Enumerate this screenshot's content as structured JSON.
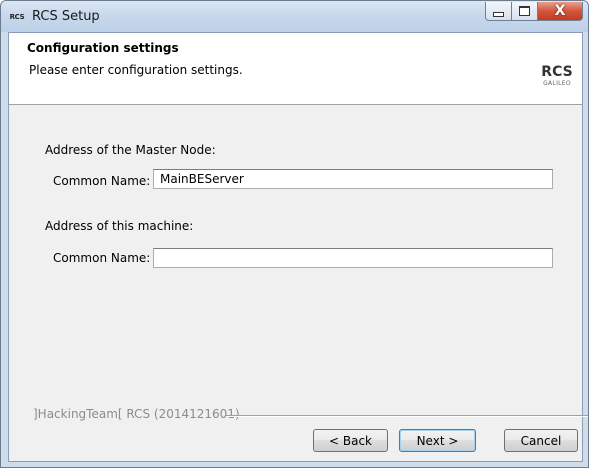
{
  "window": {
    "title": "RCS Setup",
    "app_icon_text": "RCS",
    "minimize_icon": "minimize-icon",
    "maximize_icon": "maximize-icon",
    "close_icon": "close-icon",
    "close_glyph": "X",
    "close_color": "#c13b22"
  },
  "header": {
    "title": "Configuration settings",
    "subtitle": "Please enter configuration settings.",
    "logo_main": "RCS",
    "logo_sub": "GALILEO"
  },
  "master": {
    "section_label": "Address of the Master Node:",
    "field_label": "Common Name:",
    "value": "MainBEServer"
  },
  "machine": {
    "section_label": "Address of this machine:",
    "field_label": "Common Name:",
    "value": ""
  },
  "branding": "]HackingTeam[ RCS (2014121601)",
  "buttons": {
    "back": "< Back",
    "next": "Next >",
    "cancel": "Cancel"
  }
}
